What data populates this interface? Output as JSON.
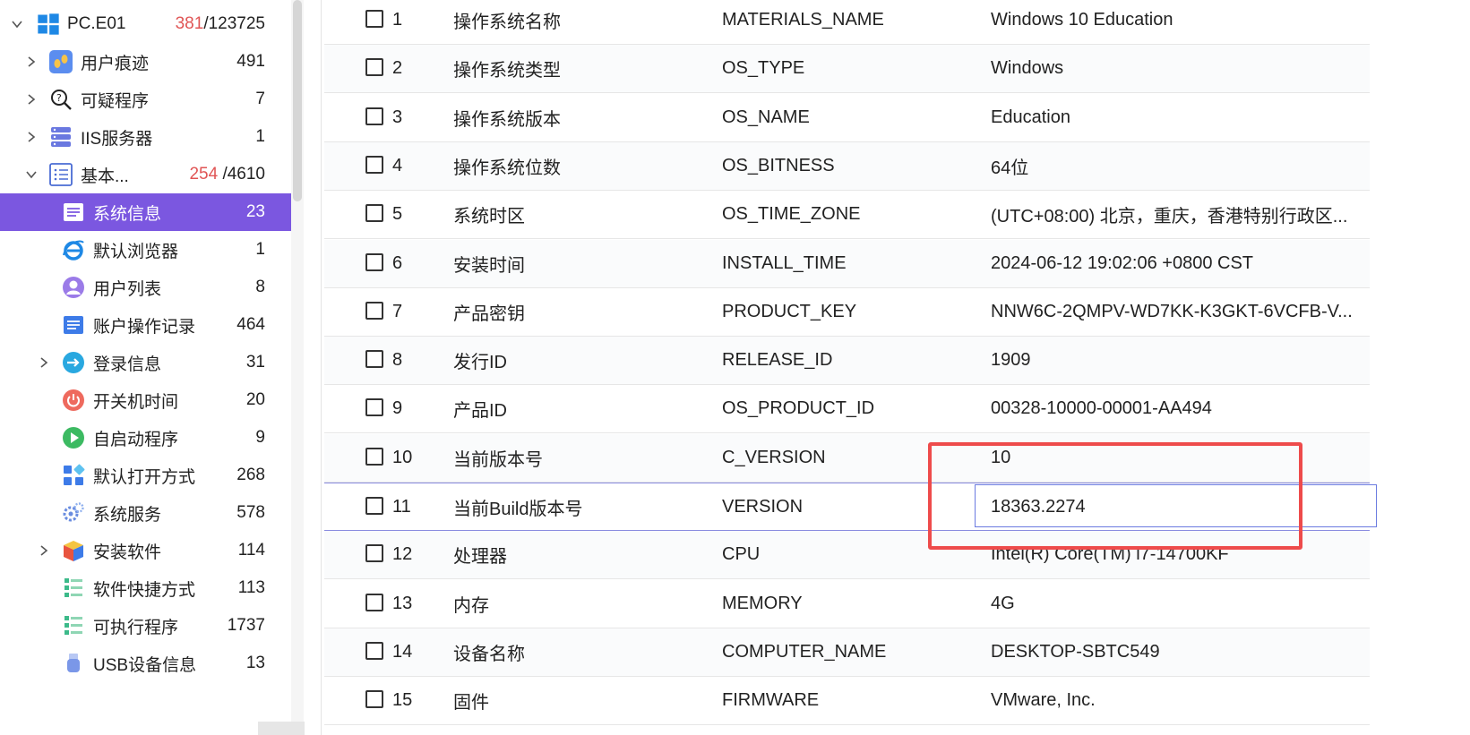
{
  "sidebar": {
    "root": {
      "label": "PC.E01",
      "count_red": "381",
      "count_rest": "/123725"
    },
    "items": [
      {
        "label": "用户痕迹",
        "count": "491"
      },
      {
        "label": "可疑程序",
        "count": "7"
      },
      {
        "label": "IIS服务器",
        "count": "1"
      },
      {
        "label": "基本...",
        "count_red": "254",
        "count_rest": " /4610"
      },
      {
        "label": "系统信息",
        "count": "23"
      },
      {
        "label": "默认浏览器",
        "count": "1"
      },
      {
        "label": "用户列表",
        "count": "8"
      },
      {
        "label": "账户操作记录",
        "count": "464"
      },
      {
        "label": "登录信息",
        "count": "31"
      },
      {
        "label": "开关机时间",
        "count": "20"
      },
      {
        "label": "自启动程序",
        "count": "9"
      },
      {
        "label": "默认打开方式",
        "count": "268"
      },
      {
        "label": "系统服务",
        "count": "578"
      },
      {
        "label": "安装软件",
        "count": "114"
      },
      {
        "label": "软件快捷方式",
        "count": "113"
      },
      {
        "label": "可执行程序",
        "count": "1737"
      },
      {
        "label": "USB设备信息",
        "count": "13"
      }
    ],
    "icons": {
      "footprints": "footprints-icon",
      "search-question": "search-question-icon",
      "server": "server-icon",
      "list": "list-icon",
      "browser": "ie-browser-icon",
      "user": "user-icon",
      "login": "login-icon",
      "power": "power-icon",
      "play": "play-icon",
      "grid": "app-grid-icon",
      "gear": "gear-icon",
      "cube": "cube-icon",
      "usb": "usb-icon"
    },
    "colors": {
      "selected_bg": "#7b57e0",
      "count_red": "#e05555"
    }
  },
  "table": {
    "rows": [
      {
        "idx": "1",
        "name": "操作系统名称",
        "key": "MATERIALS_NAME",
        "value": "Windows 10 Education"
      },
      {
        "idx": "2",
        "name": "操作系统类型",
        "key": "OS_TYPE",
        "value": "Windows"
      },
      {
        "idx": "3",
        "name": "操作系统版本",
        "key": "OS_NAME",
        "value": "Education"
      },
      {
        "idx": "4",
        "name": "操作系统位数",
        "key": "OS_BITNESS",
        "value": "64位"
      },
      {
        "idx": "5",
        "name": "系统时区",
        "key": "OS_TIME_ZONE",
        "value": "(UTC+08:00) 北京，重庆，香港特别行政区..."
      },
      {
        "idx": "6",
        "name": "安装时间",
        "key": "INSTALL_TIME",
        "value": "2024-06-12 19:02:06 +0800 CST"
      },
      {
        "idx": "7",
        "name": "产品密钥",
        "key": "PRODUCT_KEY",
        "value": "NNW6C-2QMPV-WD7KK-K3GKT-6VCFB-V..."
      },
      {
        "idx": "8",
        "name": "发行ID",
        "key": "RELEASE_ID",
        "value": "1909"
      },
      {
        "idx": "9",
        "name": "产品ID",
        "key": "OS_PRODUCT_ID",
        "value": "00328-10000-00001-AA494"
      },
      {
        "idx": "10",
        "name": "当前版本号",
        "key": "C_VERSION",
        "value": "10"
      },
      {
        "idx": "11",
        "name": "当前Build版本号",
        "key": "VERSION",
        "value": "18363.2274"
      },
      {
        "idx": "12",
        "name": "处理器",
        "key": "CPU",
        "value": "Intel(R) Core(TM) i7-14700KF"
      },
      {
        "idx": "13",
        "name": "内存",
        "key": "MEMORY",
        "value": "4G"
      },
      {
        "idx": "14",
        "name": "设备名称",
        "key": "COMPUTER_NAME",
        "value": "DESKTOP-SBTC549"
      },
      {
        "idx": "15",
        "name": "固件",
        "key": "FIRMWARE",
        "value": "VMware, Inc."
      }
    ],
    "active_row": "11",
    "colors": {
      "highlight": "#ee4b4b",
      "active_border": "#8a8ce0"
    }
  }
}
